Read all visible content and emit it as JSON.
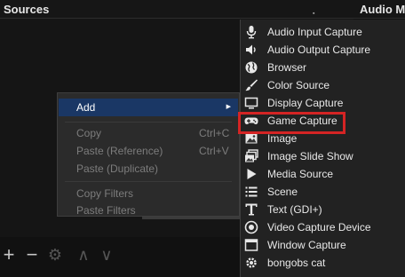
{
  "header": {
    "sources_title": "Sources",
    "audio_title": "Audio M"
  },
  "toolbar": {
    "add": "+",
    "remove": "−",
    "settings": "⚙",
    "up": "∧",
    "down": "∨"
  },
  "context_menu": {
    "items": [
      {
        "label": "Add",
        "shortcut": "",
        "enabled": true,
        "submenu": true
      },
      {
        "label": "Copy",
        "shortcut": "Ctrl+C",
        "enabled": false
      },
      {
        "label": "Paste (Reference)",
        "shortcut": "Ctrl+V",
        "enabled": false
      },
      {
        "label": "Paste (Duplicate)",
        "shortcut": "",
        "enabled": false
      },
      {
        "label": "Copy Filters",
        "shortcut": "",
        "enabled": false
      },
      {
        "label": "Paste Filters",
        "shortcut": "",
        "enabled": false
      }
    ]
  },
  "add_submenu": {
    "items": [
      {
        "label": "Audio Input Capture",
        "icon": "microphone-icon"
      },
      {
        "label": "Audio Output Capture",
        "icon": "speaker-icon"
      },
      {
        "label": "Browser",
        "icon": "globe-icon"
      },
      {
        "label": "Color Source",
        "icon": "paintbrush-icon"
      },
      {
        "label": "Display Capture",
        "icon": "monitor-icon"
      },
      {
        "label": "Game Capture",
        "icon": "gamepad-icon",
        "highlighted": true
      },
      {
        "label": "Image",
        "icon": "image-icon"
      },
      {
        "label": "Image Slide Show",
        "icon": "slideshow-icon"
      },
      {
        "label": "Media Source",
        "icon": "play-icon"
      },
      {
        "label": "Scene",
        "icon": "list-icon"
      },
      {
        "label": "Text (GDI+)",
        "icon": "text-icon"
      },
      {
        "label": "Video Capture Device",
        "icon": "camera-icon"
      },
      {
        "label": "Window Capture",
        "icon": "window-icon"
      },
      {
        "label": "bongobs cat",
        "icon": "gear-icon"
      }
    ]
  },
  "colors": {
    "accent": "#1a3765",
    "highlight_border": "#d42424"
  }
}
